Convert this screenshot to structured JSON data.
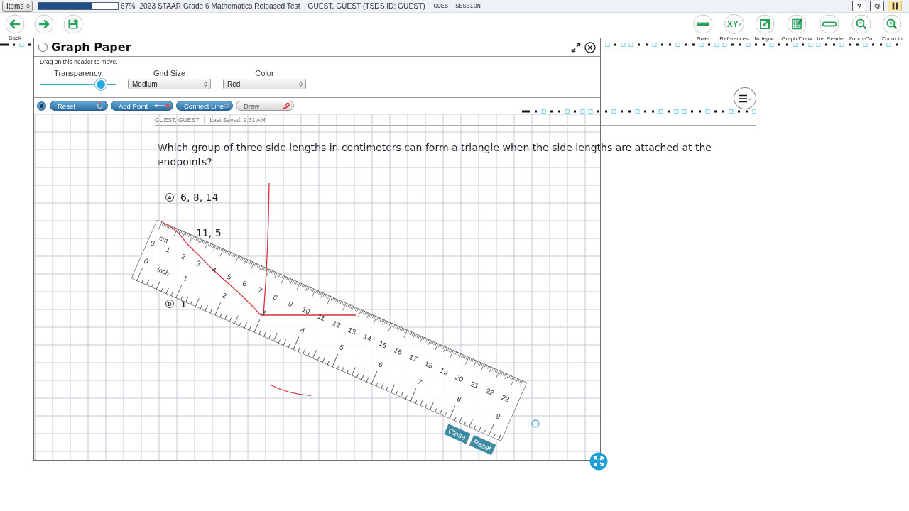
{
  "top_bar": {
    "menu": "Items",
    "progress": {
      "level": 0.67,
      "label": "67%"
    },
    "test_title": "2023 STAAR Grade 6 Mathematics Released Test",
    "student": "GUEST, GUEST (TSDS ID: GUEST)",
    "session": "GUEST SESSION",
    "buttons": [
      {
        "kind": "help",
        "label": "?"
      },
      {
        "kind": "settings"
      },
      {
        "kind": "pause"
      }
    ]
  },
  "navigation": [
    {
      "kind": "back",
      "label": "Back"
    },
    {
      "kind": "forward"
    },
    {
      "kind": "save"
    }
  ],
  "tools": [
    {
      "kind": "ruler",
      "label": "Ruler"
    },
    {
      "kind": "references",
      "symbol": "XY$^{2}$",
      "label": "References"
    },
    {
      "kind": "notepad",
      "label": "Notepad"
    },
    {
      "kind": "graph",
      "label": "Graph/Draw"
    },
    {
      "kind": "line-reader",
      "label": "Line Reader"
    },
    {
      "kind": "zoom-out",
      "label": "Zoom Out"
    },
    {
      "kind": "zoom-in",
      "label": "Zoom In"
    }
  ],
  "item": {
    "student": "GUEST, GUEST",
    "saved": "Last Saved: 9:31 AM",
    "question": "Which group of three side lengths in centimeters can form a triangle when the side lengths are attached at the endpoints?",
    "options": [
      {
        "letter": "A",
        "text": "6, 8, 14"
      },
      {
        "text": "11, 5"
      },
      {
        "letter": "D",
        "text": "1"
      }
    ]
  },
  "graph_paper": {
    "title": "Graph Paper",
    "hint": "Drag on this header to move.",
    "transparency": {
      "label": "Transparency",
      "level": 0.8
    },
    "grid_size": {
      "label": "Grid Size",
      "value": "Medium"
    },
    "color": {
      "label": "Color",
      "value": "Red"
    },
    "tools": [
      {
        "kind": "reset",
        "label": "Reset",
        "selected": false
      },
      {
        "kind": "point",
        "label": "Add Point",
        "selected": false
      },
      {
        "kind": "line",
        "label": "Connect Line",
        "selected": false
      },
      {
        "kind": "draw",
        "label": "Draw",
        "selected": true
      }
    ]
  },
  "ruler": {
    "cm_unit": "cm",
    "inch_unit": "inch",
    "cm_marks": [
      "0",
      "1",
      "2",
      "3",
      "4",
      "5",
      "6",
      "7",
      "8",
      "9",
      "10",
      "11",
      "12",
      "13",
      "14",
      "15",
      "16",
      "17",
      "18",
      "19",
      "20",
      "21",
      "22",
      "23"
    ],
    "inch_marks": [
      "0",
      "1",
      "2",
      "3",
      "4",
      "5",
      "6",
      "7",
      "8",
      "9"
    ],
    "buttons": [
      "Close",
      "Reset"
    ]
  }
}
